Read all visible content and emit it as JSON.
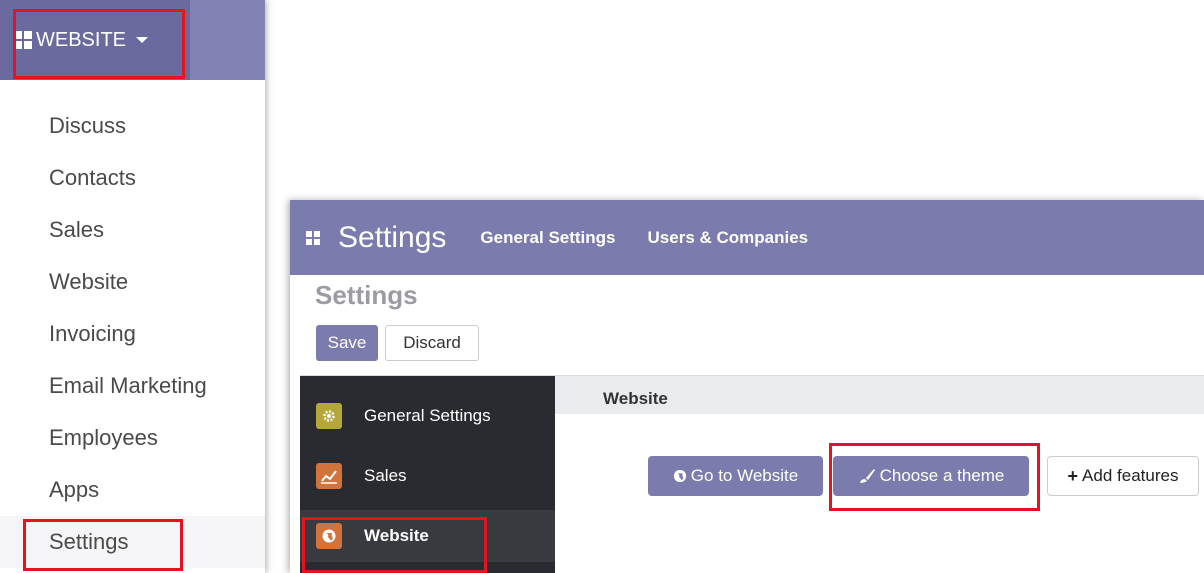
{
  "apps_menu": {
    "button_label": "WEBSITE",
    "items": [
      {
        "label": "Discuss"
      },
      {
        "label": "Contacts"
      },
      {
        "label": "Sales"
      },
      {
        "label": "Website"
      },
      {
        "label": "Invoicing"
      },
      {
        "label": "Email Marketing"
      },
      {
        "label": "Employees"
      },
      {
        "label": "Apps"
      },
      {
        "label": "Settings"
      }
    ]
  },
  "settings": {
    "app_title": "Settings",
    "nav": [
      "General Settings",
      "Users & Companies"
    ],
    "page_title": "Settings",
    "save_label": "Save",
    "discard_label": "Discard",
    "sidebar": [
      {
        "label": "General Settings",
        "icon": "gear-icon",
        "color": "#b5a83a"
      },
      {
        "label": "Sales",
        "icon": "chart-icon",
        "color": "#d3733c"
      },
      {
        "label": "Website",
        "icon": "globe-icon",
        "color": "#d3733c"
      }
    ],
    "section_title": "Website",
    "go_to_website": "Go to Website",
    "choose_theme": "Choose a theme",
    "add_features": "Add features"
  },
  "colors": {
    "brand": "#7c7bad",
    "highlight": "#e1141f",
    "sidebar_bg": "#2a2b30"
  }
}
